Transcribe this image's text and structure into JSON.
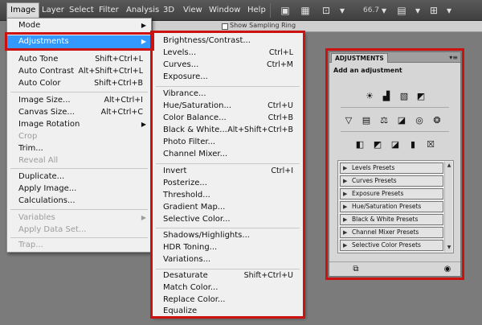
{
  "menubar": {
    "items": [
      {
        "label": "Image",
        "active": true
      },
      {
        "label": "Layer"
      },
      {
        "label": "Select"
      },
      {
        "label": "Filter"
      },
      {
        "label": "Analysis"
      },
      {
        "label": "3D"
      },
      {
        "label": "View"
      },
      {
        "label": "Window"
      },
      {
        "label": "Help"
      }
    ],
    "zoom_value": "66.7"
  },
  "options_strip": {
    "sample_label": "Show Sampling Ring"
  },
  "image_menu": {
    "items": [
      {
        "label": "Mode",
        "arrow": "▶"
      },
      {
        "label": "Adjustments",
        "arrow": "▶",
        "highlighted": true
      },
      {
        "label": "Auto Tone",
        "shortcut": "Shift+Ctrl+L"
      },
      {
        "label": "Auto Contrast",
        "shortcut": "Alt+Shift+Ctrl+L"
      },
      {
        "label": "Auto Color",
        "shortcut": "Shift+Ctrl+B"
      },
      {
        "label": "Image Size...",
        "shortcut": "Alt+Ctrl+I"
      },
      {
        "label": "Canvas Size...",
        "shortcut": "Alt+Ctrl+C"
      },
      {
        "label": "Image Rotation",
        "arrow": "▶"
      },
      {
        "label": "Crop",
        "disabled": true
      },
      {
        "label": "Trim..."
      },
      {
        "label": "Reveal All",
        "disabled": true
      },
      {
        "label": "Duplicate..."
      },
      {
        "label": "Apply Image..."
      },
      {
        "label": "Calculations..."
      },
      {
        "label": "Variables",
        "arrow": "▶",
        "disabled": true
      },
      {
        "label": "Apply Data Set...",
        "disabled": true
      },
      {
        "label": "Trap...",
        "disabled": true
      }
    ]
  },
  "adjustments_menu": {
    "items": [
      {
        "label": "Brightness/Contrast..."
      },
      {
        "label": "Levels...",
        "shortcut": "Ctrl+L"
      },
      {
        "label": "Curves...",
        "shortcut": "Ctrl+M"
      },
      {
        "label": "Exposure..."
      },
      {
        "label": "Vibrance..."
      },
      {
        "label": "Hue/Saturation...",
        "shortcut": "Ctrl+U"
      },
      {
        "label": "Color Balance...",
        "shortcut": "Ctrl+B"
      },
      {
        "label": "Black & White...",
        "shortcut": "Alt+Shift+Ctrl+B"
      },
      {
        "label": "Photo Filter..."
      },
      {
        "label": "Channel Mixer..."
      },
      {
        "label": "Invert",
        "shortcut": "Ctrl+I"
      },
      {
        "label": "Posterize..."
      },
      {
        "label": "Threshold..."
      },
      {
        "label": "Gradient Map..."
      },
      {
        "label": "Selective Color..."
      },
      {
        "label": "Shadows/Highlights..."
      },
      {
        "label": "HDR Toning..."
      },
      {
        "label": "Variations..."
      },
      {
        "label": "Desaturate",
        "shortcut": "Shift+Ctrl+U"
      },
      {
        "label": "Match Color..."
      },
      {
        "label": "Replace Color..."
      },
      {
        "label": "Equalize"
      }
    ]
  },
  "panel": {
    "tab_label": "ADJUSTMENTS",
    "heading": "Add an adjustment",
    "icons_row1": [
      "brightness-icon",
      "levels-icon",
      "curves-icon",
      "exposure-icon"
    ],
    "icons_row2": [
      "vibrance-icon",
      "hue-saturation-icon",
      "color-balance-icon",
      "black-white-icon",
      "photo-filter-icon",
      "channel-mixer-icon"
    ],
    "icons_row3": [
      "invert-icon",
      "posterize-icon",
      "threshold-icon",
      "gradient-map-icon",
      "selective-color-icon"
    ],
    "presets": [
      "Levels Presets",
      "Curves Presets",
      "Exposure Presets",
      "Hue/Saturation Presets",
      "Black & White Presets",
      "Channel Mixer Presets",
      "Selective Color Presets"
    ]
  },
  "colors": {
    "highlight": "#3399ff",
    "annotation_red": "#cc1111"
  }
}
